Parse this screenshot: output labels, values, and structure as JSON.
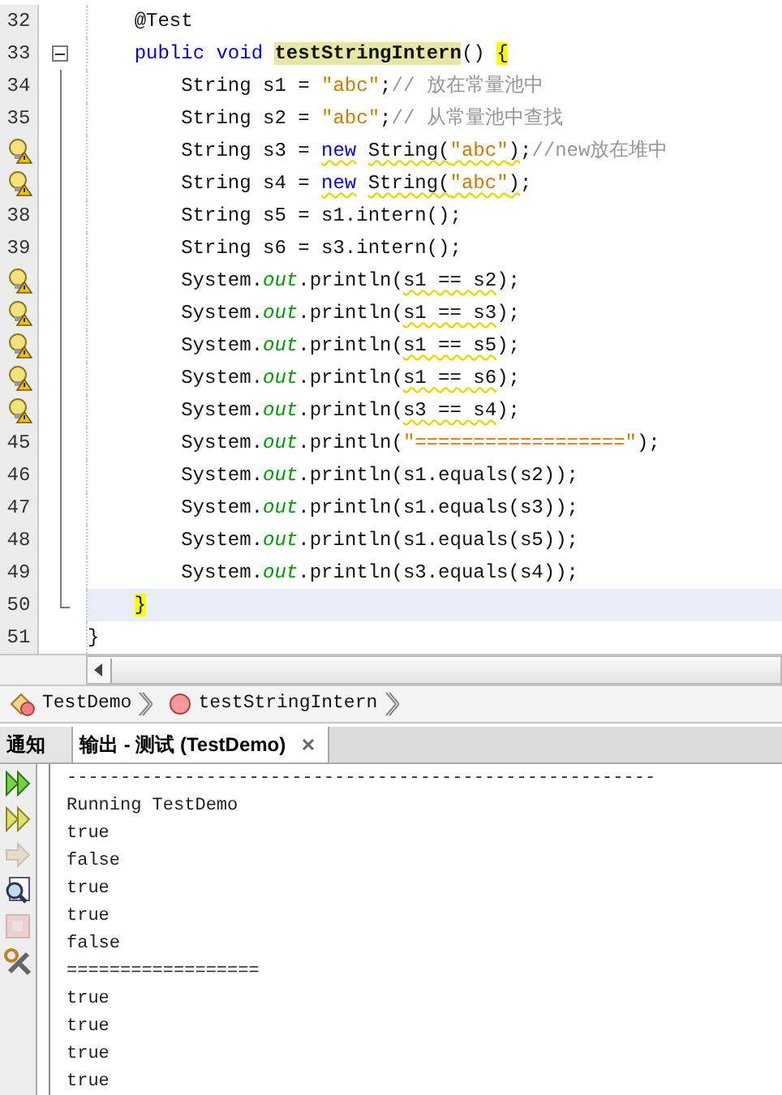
{
  "editor": {
    "lines": [
      {
        "gutter": {
          "kind": "number",
          "text": "32"
        },
        "fold_start": false,
        "fold_end": false,
        "current": false,
        "tokens": [
          {
            "text": "    @Test",
            "kind": "plain",
            "warn": false
          }
        ]
      },
      {
        "gutter": {
          "kind": "number",
          "text": "33"
        },
        "fold_start": true,
        "fold_end": false,
        "current": false,
        "tokens": [
          {
            "text": "    public void ",
            "kind": "keyword",
            "warn": false
          },
          {
            "text": "testStringIntern",
            "kind": "method",
            "warn": false
          },
          {
            "text": "() ",
            "kind": "plain",
            "warn": false
          },
          {
            "text": "{",
            "kind": "brace-match",
            "warn": false
          }
        ]
      },
      {
        "gutter": {
          "kind": "number",
          "text": "34"
        },
        "fold_start": false,
        "fold_end": false,
        "current": false,
        "tokens": [
          {
            "text": "        String s1 = ",
            "kind": "plain",
            "warn": false
          },
          {
            "text": "\"abc\"",
            "kind": "string",
            "warn": false
          },
          {
            "text": ";",
            "kind": "plain",
            "warn": false
          },
          {
            "text": "// 放在常量池中",
            "kind": "comment",
            "warn": false
          }
        ]
      },
      {
        "gutter": {
          "kind": "number",
          "text": "35"
        },
        "fold_start": false,
        "fold_end": false,
        "current": false,
        "tokens": [
          {
            "text": "        String s2 = ",
            "kind": "plain",
            "warn": false
          },
          {
            "text": "\"abc\"",
            "kind": "string",
            "warn": false
          },
          {
            "text": ";",
            "kind": "plain",
            "warn": false
          },
          {
            "text": "// 从常量池中查找",
            "kind": "comment",
            "warn": false
          }
        ]
      },
      {
        "gutter": {
          "kind": "hint"
        },
        "fold_start": false,
        "fold_end": false,
        "current": false,
        "tokens": [
          {
            "text": "        String s3 = ",
            "kind": "plain",
            "warn": false
          },
          {
            "text": "new",
            "kind": "keyword",
            "warn": true
          },
          {
            "text": " String(",
            "kind": "plain",
            "warn": true
          },
          {
            "text": "\"abc\"",
            "kind": "string",
            "warn": true
          },
          {
            "text": ")",
            "kind": "plain",
            "warn": true
          },
          {
            "text": ";",
            "kind": "plain",
            "warn": false
          },
          {
            "text": "//new放在堆中",
            "kind": "comment",
            "warn": false
          }
        ]
      },
      {
        "gutter": {
          "kind": "hint"
        },
        "fold_start": false,
        "fold_end": false,
        "current": false,
        "tokens": [
          {
            "text": "        String s4 = ",
            "kind": "plain",
            "warn": false
          },
          {
            "text": "new",
            "kind": "keyword",
            "warn": true
          },
          {
            "text": " String(",
            "kind": "plain",
            "warn": true
          },
          {
            "text": "\"abc\"",
            "kind": "string",
            "warn": true
          },
          {
            "text": ")",
            "kind": "plain",
            "warn": true
          },
          {
            "text": ";",
            "kind": "plain",
            "warn": false
          }
        ]
      },
      {
        "gutter": {
          "kind": "number",
          "text": "38"
        },
        "fold_start": false,
        "fold_end": false,
        "current": false,
        "tokens": [
          {
            "text": "        String s5 = s1.intern();",
            "kind": "plain",
            "warn": false
          }
        ]
      },
      {
        "gutter": {
          "kind": "number",
          "text": "39"
        },
        "fold_start": false,
        "fold_end": false,
        "current": false,
        "tokens": [
          {
            "text": "        String s6 = s3.intern();",
            "kind": "plain",
            "warn": false
          }
        ]
      },
      {
        "gutter": {
          "kind": "hint"
        },
        "fold_start": false,
        "fold_end": false,
        "current": false,
        "tokens": [
          {
            "text": "        System.",
            "kind": "plain",
            "warn": false
          },
          {
            "text": "out",
            "kind": "field",
            "warn": false
          },
          {
            "text": ".println(",
            "kind": "plain",
            "warn": false
          },
          {
            "text": "s1 == s2",
            "kind": "plain",
            "warn": true
          },
          {
            "text": ");",
            "kind": "plain",
            "warn": false
          }
        ]
      },
      {
        "gutter": {
          "kind": "hint"
        },
        "fold_start": false,
        "fold_end": false,
        "current": false,
        "tokens": [
          {
            "text": "        System.",
            "kind": "plain",
            "warn": false
          },
          {
            "text": "out",
            "kind": "field",
            "warn": false
          },
          {
            "text": ".println(",
            "kind": "plain",
            "warn": false
          },
          {
            "text": "s1 == s3",
            "kind": "plain",
            "warn": true
          },
          {
            "text": ");",
            "kind": "plain",
            "warn": false
          }
        ]
      },
      {
        "gutter": {
          "kind": "hint"
        },
        "fold_start": false,
        "fold_end": false,
        "current": false,
        "tokens": [
          {
            "text": "        System.",
            "kind": "plain",
            "warn": false
          },
          {
            "text": "out",
            "kind": "field",
            "warn": false
          },
          {
            "text": ".println(",
            "kind": "plain",
            "warn": false
          },
          {
            "text": "s1 == s5",
            "kind": "plain",
            "warn": true
          },
          {
            "text": ");",
            "kind": "plain",
            "warn": false
          }
        ]
      },
      {
        "gutter": {
          "kind": "hint"
        },
        "fold_start": false,
        "fold_end": false,
        "current": false,
        "tokens": [
          {
            "text": "        System.",
            "kind": "plain",
            "warn": false
          },
          {
            "text": "out",
            "kind": "field",
            "warn": false
          },
          {
            "text": ".println(",
            "kind": "plain",
            "warn": false
          },
          {
            "text": "s1 == s6",
            "kind": "plain",
            "warn": true
          },
          {
            "text": ");",
            "kind": "plain",
            "warn": false
          }
        ]
      },
      {
        "gutter": {
          "kind": "hint"
        },
        "fold_start": false,
        "fold_end": false,
        "current": false,
        "tokens": [
          {
            "text": "        System.",
            "kind": "plain",
            "warn": false
          },
          {
            "text": "out",
            "kind": "field",
            "warn": false
          },
          {
            "text": ".println(",
            "kind": "plain",
            "warn": false
          },
          {
            "text": "s3 == s4",
            "kind": "plain",
            "warn": true
          },
          {
            "text": ");",
            "kind": "plain",
            "warn": false
          }
        ]
      },
      {
        "gutter": {
          "kind": "number",
          "text": "45"
        },
        "fold_start": false,
        "fold_end": false,
        "current": false,
        "tokens": [
          {
            "text": "        System.",
            "kind": "plain",
            "warn": false
          },
          {
            "text": "out",
            "kind": "field",
            "warn": false
          },
          {
            "text": ".println(",
            "kind": "plain",
            "warn": false
          },
          {
            "text": "\"==================\"",
            "kind": "string",
            "warn": false
          },
          {
            "text": ");",
            "kind": "plain",
            "warn": false
          }
        ]
      },
      {
        "gutter": {
          "kind": "number",
          "text": "46"
        },
        "fold_start": false,
        "fold_end": false,
        "current": false,
        "tokens": [
          {
            "text": "        System.",
            "kind": "plain",
            "warn": false
          },
          {
            "text": "out",
            "kind": "field",
            "warn": false
          },
          {
            "text": ".println(s1.equals(s2));",
            "kind": "plain",
            "warn": false
          }
        ]
      },
      {
        "gutter": {
          "kind": "number",
          "text": "47"
        },
        "fold_start": false,
        "fold_end": false,
        "current": false,
        "tokens": [
          {
            "text": "        System.",
            "kind": "plain",
            "warn": false
          },
          {
            "text": "out",
            "kind": "field",
            "warn": false
          },
          {
            "text": ".println(s1.equals(s3));",
            "kind": "plain",
            "warn": false
          }
        ]
      },
      {
        "gutter": {
          "kind": "number",
          "text": "48"
        },
        "fold_start": false,
        "fold_end": false,
        "current": false,
        "tokens": [
          {
            "text": "        System.",
            "kind": "plain",
            "warn": false
          },
          {
            "text": "out",
            "kind": "field",
            "warn": false
          },
          {
            "text": ".println(s1.equals(s5));",
            "kind": "plain",
            "warn": false
          }
        ]
      },
      {
        "gutter": {
          "kind": "number",
          "text": "49"
        },
        "fold_start": false,
        "fold_end": false,
        "current": false,
        "tokens": [
          {
            "text": "        System.",
            "kind": "plain",
            "warn": false
          },
          {
            "text": "out",
            "kind": "field",
            "warn": false
          },
          {
            "text": ".println(s3.equals(s4));",
            "kind": "plain",
            "warn": false
          }
        ]
      },
      {
        "gutter": {
          "kind": "number",
          "text": "50"
        },
        "fold_start": false,
        "fold_end": true,
        "current": true,
        "tokens": [
          {
            "text": "    }",
            "kind": "brace-match",
            "warn": false
          }
        ]
      },
      {
        "gutter": {
          "kind": "number",
          "text": "51"
        },
        "fold_start": false,
        "fold_end": false,
        "current": false,
        "tokens": [
          {
            "text": "}",
            "kind": "plain",
            "warn": false
          }
        ]
      }
    ]
  },
  "breadcrumbs": [
    {
      "kind": "class",
      "label": "TestDemo"
    },
    {
      "kind": "method",
      "label": "testStringIntern"
    }
  ],
  "tabs": [
    {
      "label": "通知",
      "selected": false,
      "closable": false
    },
    {
      "label": "输出 - 测试 (TestDemo)",
      "selected": true,
      "closable": true
    }
  ],
  "output_toolbar": [
    {
      "kind": "rerun",
      "disabled": false
    },
    {
      "kind": "rerun-with",
      "disabled": false
    },
    {
      "kind": "next",
      "disabled": true
    },
    {
      "kind": "find",
      "disabled": false
    },
    {
      "kind": "stop",
      "disabled": true
    },
    {
      "kind": "settings",
      "disabled": false
    }
  ],
  "output": [
    "-------------------------------------------------------",
    "Running TestDemo",
    "true",
    "false",
    "true",
    "true",
    "false",
    "==================",
    "true",
    "true",
    "true",
    "true"
  ]
}
